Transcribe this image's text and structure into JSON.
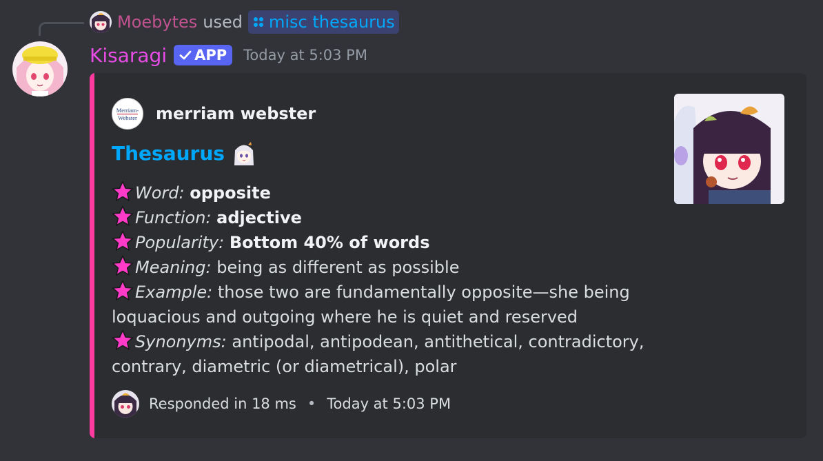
{
  "reply": {
    "user": "Moebytes",
    "used_text": "used",
    "command": "misc thesaurus"
  },
  "message": {
    "username": "Kisaragi",
    "badge": "APP",
    "timestamp": "Today at 5:03 PM"
  },
  "embed": {
    "accent_color": "#ff3ba0",
    "author_logo_text": "Merriam-Webster",
    "author_name": "merriam webster",
    "title": "Thesaurus",
    "fields": {
      "word_label": "Word:",
      "word_value": "opposite",
      "function_label": "Function:",
      "function_value": "adjective",
      "popularity_label": "Popularity:",
      "popularity_value": "Bottom 40% of words",
      "meaning_label": "Meaning:",
      "meaning_value": "being as different as possible",
      "example_label": "Example:",
      "example_value": "those two are fundamentally opposite—she being loquacious and outgoing where he is quiet and reserved",
      "synonyms_label": "Synonyms:",
      "synonyms_value": "antipodal, antipodean, antithetical, contradictory, contrary, diametric (or diametrical), polar"
    },
    "footer": {
      "text": "Responded in 18 ms",
      "separator": "•",
      "timestamp": "Today at 5:03 PM"
    }
  },
  "colors": {
    "background": "#313338",
    "embed_bg": "#2b2d31",
    "link_blue": "#00a8fc",
    "username_pink": "#e94ce6",
    "reply_user": "#c2528f",
    "badge_blurple": "#5865f2",
    "star_pink": "#ff3bc8"
  }
}
